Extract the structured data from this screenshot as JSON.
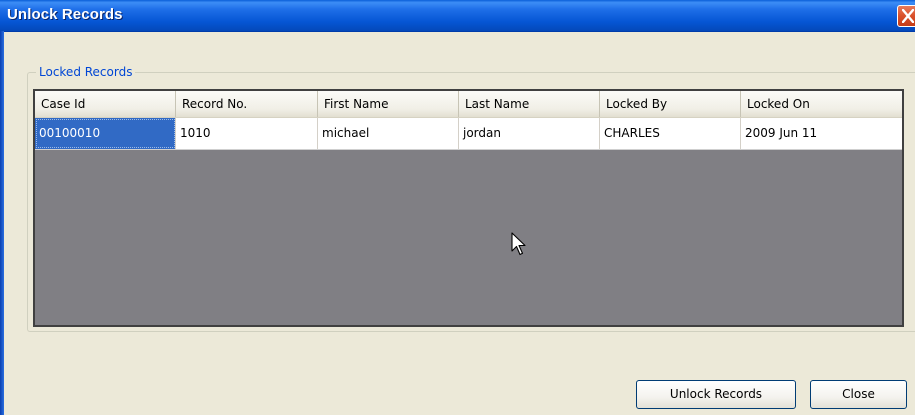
{
  "window": {
    "title": "Unlock Records"
  },
  "group": {
    "label": "Locked Records"
  },
  "table": {
    "columns": [
      "Case Id",
      "Record No.",
      "First Name",
      "Last Name",
      "Locked By",
      "Locked On"
    ],
    "rows": [
      [
        "00100010",
        "1010",
        "michael",
        "jordan",
        "CHARLES",
        "2009 Jun 11"
      ]
    ],
    "selected_cell": {
      "row": 0,
      "column": 0
    }
  },
  "buttons": {
    "unlock_label": "Unlock Records",
    "close_label": "Close"
  },
  "icons": {
    "close": "close-icon",
    "cursor": "mouse-pointer-icon"
  },
  "colors": {
    "titlebar": "#0556d4",
    "group_label": "#0046d5",
    "grid_background": "#807f84",
    "selection": "#316ac5",
    "dialog_background": "#ece9d8"
  }
}
